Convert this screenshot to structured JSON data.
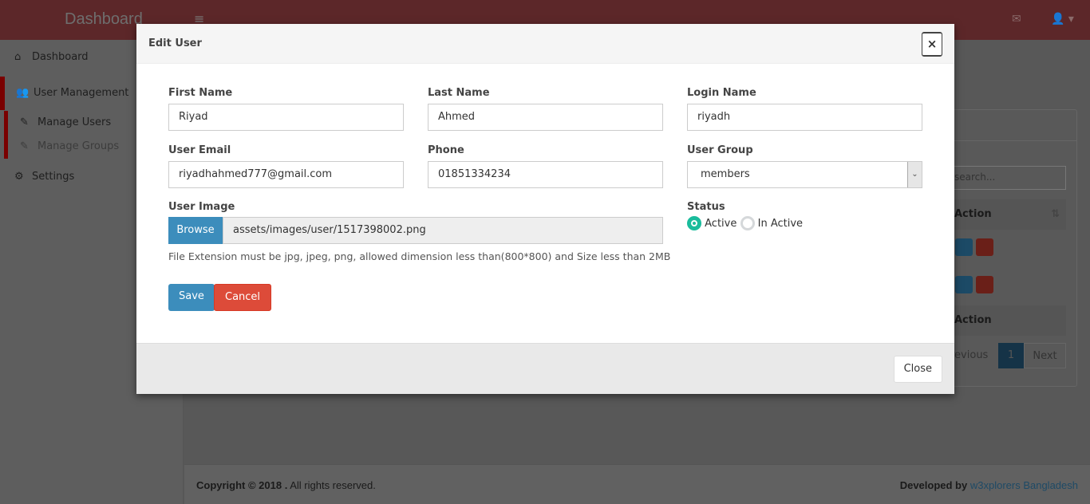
{
  "header": {
    "logo": "Dashboard",
    "menu_icon": "bars-icon",
    "mail_icon": "envelope-icon",
    "user_icon": "user-icon"
  },
  "sidebar": {
    "items": [
      {
        "label": "Dashboard",
        "icon": "home-icon"
      },
      {
        "label": "User Management",
        "icon": "users-icon"
      },
      {
        "label": "Manage Users",
        "icon": "edit-icon"
      },
      {
        "label": "Manage Groups",
        "icon": "edit-icon"
      },
      {
        "label": "Settings",
        "icon": "cogs-icon"
      }
    ]
  },
  "background": {
    "search_placeholder": "search...",
    "action_header": "Action",
    "action_footer": "Action",
    "pagination": {
      "previous": "revious",
      "page": "1",
      "next": "Next"
    }
  },
  "footer": {
    "copyright": "Copyright © 2018 .",
    "rights": " All rights reserved.",
    "developed_by": "Developed by",
    "company": "w3xplorers Bangladesh"
  },
  "modal": {
    "title": "Edit User",
    "close_x": "×",
    "fields": {
      "first_name": {
        "label": "First Name",
        "value": "Riyad"
      },
      "last_name": {
        "label": "Last Name",
        "value": "Ahmed"
      },
      "login_name": {
        "label": "Login Name",
        "value": "riyadh"
      },
      "email": {
        "label": "User Email",
        "value": "riyadhahmed777@gmail.com"
      },
      "phone": {
        "label": "Phone",
        "value": "01851334234"
      },
      "group": {
        "label": "User Group",
        "value": "members"
      },
      "image": {
        "label": "User Image",
        "browse": "Browse",
        "value": "assets/images/user/1517398002.png",
        "hint": "File Extension must be jpg, jpeg, png, allowed dimension less than(800*800) and Size less than 2MB"
      },
      "status": {
        "label": "Status",
        "options": [
          "Active",
          "In Active"
        ],
        "selected": "Active"
      }
    },
    "save": "Save",
    "cancel": "Cancel",
    "close": "Close"
  },
  "colors": {
    "primary": "#3c8dbc",
    "danger": "#dd4b39",
    "radio_active": "#1abc9c"
  }
}
